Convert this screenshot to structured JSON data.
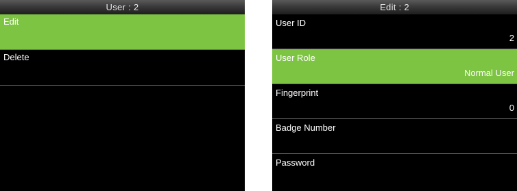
{
  "left_screen": {
    "title": "User : 2",
    "menu": [
      {
        "label": "Edit",
        "selected": true
      },
      {
        "label": "Delete",
        "selected": false
      }
    ]
  },
  "right_screen": {
    "title": "Edit : 2",
    "fields": [
      {
        "label": "User ID",
        "value": "2",
        "selected": false
      },
      {
        "label": "User Role",
        "value": "Normal User",
        "selected": true
      },
      {
        "label": "Fingerprint",
        "value": "0",
        "selected": false
      },
      {
        "label": "Badge Number",
        "value": "",
        "selected": false
      },
      {
        "label": "Password",
        "value": "",
        "selected": false
      }
    ]
  },
  "colors": {
    "highlight": "#7dc443",
    "background": "#000000",
    "titlebar": "#3a3a3a",
    "divider": "#6a6a6a"
  }
}
